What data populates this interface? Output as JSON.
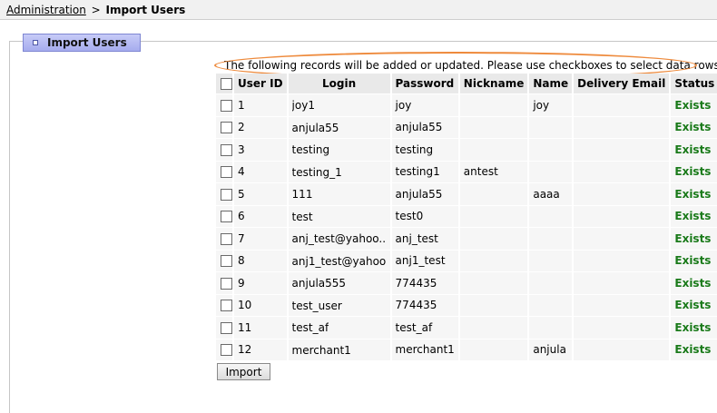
{
  "breadcrumb": {
    "root": "Administration",
    "separator": ">",
    "current": "Import Users"
  },
  "panel": {
    "tab_label": "Import Users"
  },
  "note": "The following records will be added or updated. Please use checkboxes to select data rows.",
  "table": {
    "headers": [
      "User ID",
      "Login",
      "Password",
      "Nickname",
      "Name",
      "Delivery Email",
      "Status"
    ],
    "rows": [
      {
        "id": "1",
        "login": "joy1",
        "password": "joy",
        "nickname": "",
        "name": "joy",
        "email": "",
        "status": "Exists"
      },
      {
        "id": "2",
        "login": "anjula55",
        "password": "anjula55",
        "nickname": "",
        "name": "",
        "email": "",
        "status": "Exists"
      },
      {
        "id": "3",
        "login": "testing",
        "password": "testing",
        "nickname": "",
        "name": "",
        "email": "",
        "status": "Exists"
      },
      {
        "id": "4",
        "login": "testing_1",
        "password": "testing1",
        "nickname": "antest",
        "name": "",
        "email": "",
        "status": "Exists"
      },
      {
        "id": "5",
        "login": "111",
        "password": "anjula55",
        "nickname": "",
        "name": "aaaa",
        "email": "",
        "status": "Exists"
      },
      {
        "id": "6",
        "login": "test",
        "password": "test0",
        "nickname": "",
        "name": "",
        "email": "",
        "status": "Exists"
      },
      {
        "id": "7",
        "login": "anj_test@yahoo....",
        "password": "anj_test",
        "nickname": "",
        "name": "",
        "email": "",
        "status": "Exists"
      },
      {
        "id": "8",
        "login": "anj1_test@yahoo....",
        "password": "anj1_test",
        "nickname": "",
        "name": "",
        "email": "",
        "status": "Exists"
      },
      {
        "id": "9",
        "login": "anjula555",
        "password": "774435",
        "nickname": "",
        "name": "",
        "email": "",
        "status": "Exists"
      },
      {
        "id": "10",
        "login": "test_user",
        "password": "774435",
        "nickname": "",
        "name": "",
        "email": "",
        "status": "Exists"
      },
      {
        "id": "11",
        "login": "test_af",
        "password": "test_af",
        "nickname": "",
        "name": "",
        "email": "",
        "status": "Exists"
      },
      {
        "id": "12",
        "login": "merchant1",
        "password": "merchant1",
        "nickname": "",
        "name": "anjula",
        "email": "",
        "status": "Exists"
      }
    ]
  },
  "import_button": "Import",
  "colors": {
    "status_exists": "#1a7a1a",
    "annotation_ellipse": "#ee8a3c",
    "tab_bg": "#b4b9f2"
  }
}
